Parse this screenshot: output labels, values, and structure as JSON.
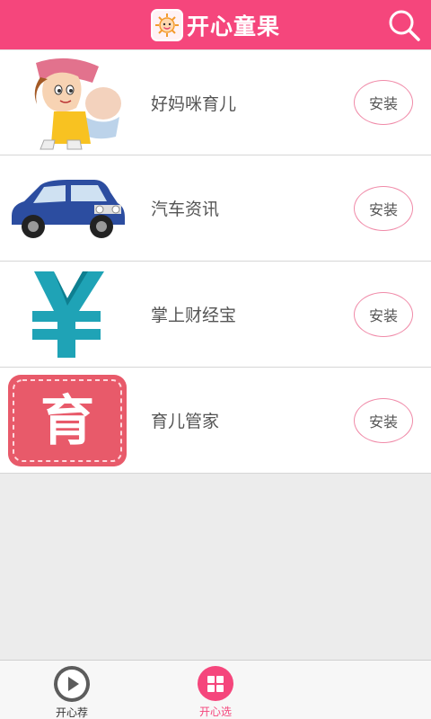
{
  "header": {
    "title": "开心童果",
    "logo_icon": "sun-face-icon",
    "search_icon": "search-icon",
    "color": "#f5467c"
  },
  "apps": [
    {
      "name": "好妈咪育儿",
      "install_label": "安装",
      "thumb_icon": "mom-baby-cartoon"
    },
    {
      "name": "汽车资讯",
      "install_label": "安装",
      "thumb_icon": "car-icon"
    },
    {
      "name": "掌上财经宝",
      "install_label": "安装",
      "thumb_icon": "yen-icon"
    },
    {
      "name": "育儿管家",
      "install_label": "安装",
      "thumb_icon": "yu-character-icon",
      "thumb_text": "育"
    }
  ],
  "tabbar": {
    "tabs": [
      {
        "label": "开心荐",
        "icon": "play-icon",
        "active": false
      },
      {
        "label": "开心选",
        "icon": "grid-icon",
        "active": true
      }
    ]
  }
}
